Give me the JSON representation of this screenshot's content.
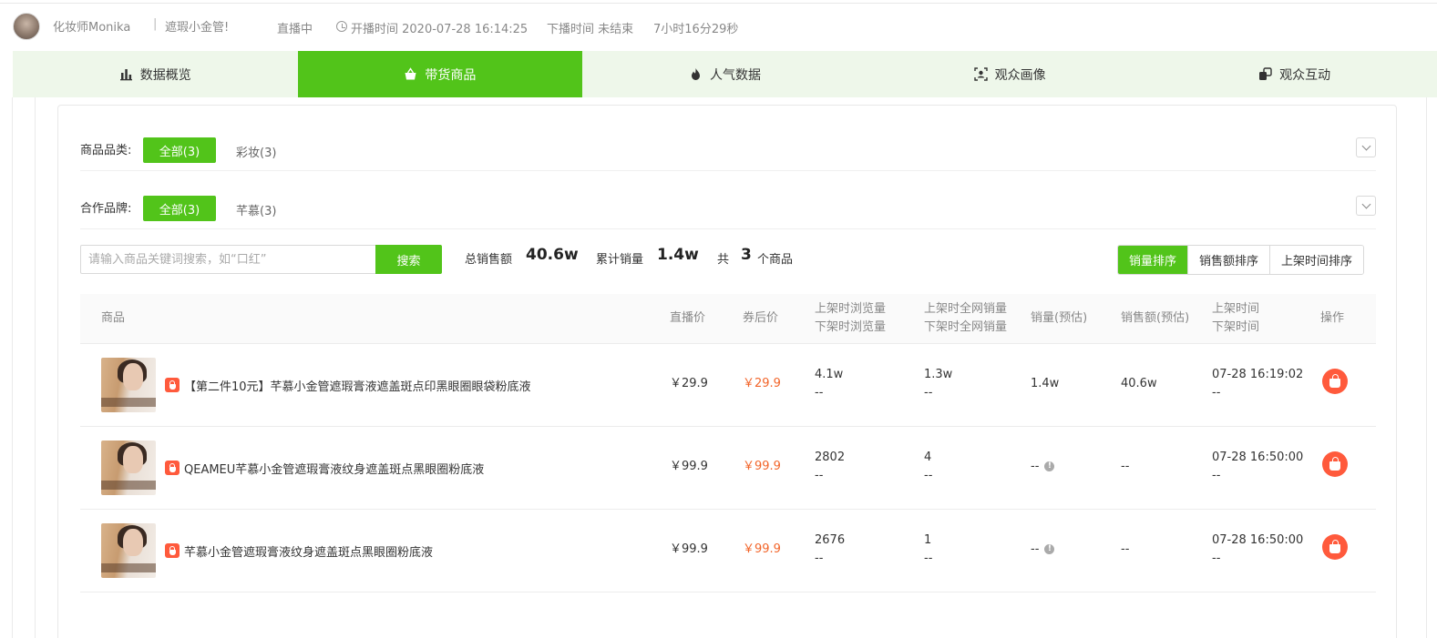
{
  "header": {
    "anchor_name": "化妆师Monika",
    "separator": "|",
    "live_title": "遮瑕小金管!",
    "status": "直播中",
    "start_time": "开播时间 2020-07-28 16:14:25",
    "end_time": "下播时间 未结束",
    "duration": "7小时16分29秒"
  },
  "tabs": [
    {
      "label": "数据概览",
      "icon": "bar-chart-icon",
      "active": false
    },
    {
      "label": "带货商品",
      "icon": "shopping-basket-icon",
      "active": true
    },
    {
      "label": "人气数据",
      "icon": "flame-icon",
      "active": false
    },
    {
      "label": "观众画像",
      "icon": "user-scan-icon",
      "active": false
    },
    {
      "label": "观众互动",
      "icon": "interaction-icon",
      "active": false
    }
  ],
  "filters": {
    "category": {
      "label": "商品品类:",
      "all": "全部(3)",
      "option": "彩妆(3)"
    },
    "brand": {
      "label": "合作品牌:",
      "all": "全部(3)",
      "option": "芊慕(3)"
    }
  },
  "search": {
    "placeholder": "请输入商品关键词搜索，如“口红”",
    "button": "搜索"
  },
  "stats": {
    "total_sales_label": "总销售额",
    "total_sales_value": "40.6w",
    "total_volume_label": "累计销量",
    "total_volume_value": "1.4w",
    "count_prefix": "共",
    "count_value": "3",
    "count_suffix": "个商品"
  },
  "sort": {
    "by_volume": "销量排序",
    "by_sales": "销售额排序",
    "by_time": "上架时间排序"
  },
  "table": {
    "headers": {
      "product": "商品",
      "live_price": "直播价",
      "coupon_price": "券后价",
      "views_up": "上架时浏览量",
      "views_down": "下架时浏览量",
      "net_sales_up": "上架时全网销量",
      "net_sales_down": "下架时全网销量",
      "volume": "销量(预估)",
      "revenue": "销售额(预估)",
      "time_up": "上架时间",
      "time_down": "下架时间",
      "action": "操作"
    },
    "rows": [
      {
        "name": "【第二件10元】芊慕小金管遮瑕膏液遮盖斑点印黑眼圈眼袋粉底液",
        "live_price": "￥29.9",
        "coupon_price": "￥29.9",
        "views_up": "4.1w",
        "views_down": "--",
        "net_up": "1.3w",
        "net_down": "--",
        "volume": "1.4w",
        "revenue": "40.6w",
        "time_up": "07-28 16:19:02",
        "time_down": "--"
      },
      {
        "name": "QEAMEU芊慕小金管遮瑕膏液纹身遮盖斑点黑眼圈粉底液",
        "live_price": "￥99.9",
        "coupon_price": "￥99.9",
        "views_up": "2802",
        "views_down": "--",
        "net_up": "4",
        "net_down": "--",
        "volume": "--",
        "revenue": "--",
        "time_up": "07-28 16:50:00",
        "time_down": "--"
      },
      {
        "name": "芊慕小金管遮瑕膏液纹身遮盖斑点黑眼圈粉底液",
        "live_price": "￥99.9",
        "coupon_price": "￥99.9",
        "views_up": "2676",
        "views_down": "--",
        "net_up": "1",
        "net_down": "--",
        "volume": "--",
        "revenue": "--",
        "time_up": "07-28 16:50:00",
        "time_down": "--"
      }
    ]
  },
  "colors": {
    "accent": "#52c41a",
    "tab_bar_bg": "#eef7ea",
    "price_red": "#f2652a",
    "action_red": "#ff5a3c"
  }
}
